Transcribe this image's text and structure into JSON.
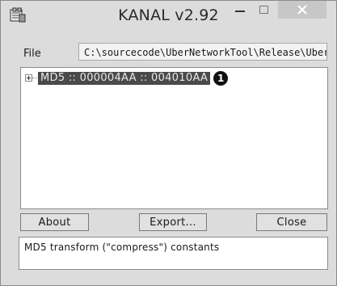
{
  "window": {
    "title": "KANAL v2.92"
  },
  "titlebar_buttons": {
    "minimize": "–",
    "maximize": "□",
    "close": "✕"
  },
  "file": {
    "label": "File",
    "path": "C:\\sourcecode\\UberNetworkTool\\Release\\Uber"
  },
  "tree": {
    "nodes": [
      {
        "label": "MD5 :: 000004AA :: 004010AA",
        "expander": "+",
        "badge": "1",
        "selected": true
      }
    ]
  },
  "buttons": {
    "about": "About",
    "export": "Export...",
    "close": "Close"
  },
  "status": {
    "text": "MD5 transform (\"compress\") constants"
  },
  "icons": {
    "app": "app-icon",
    "minimize": "minimize-icon",
    "maximize": "maximize-icon",
    "close": "close-icon"
  }
}
